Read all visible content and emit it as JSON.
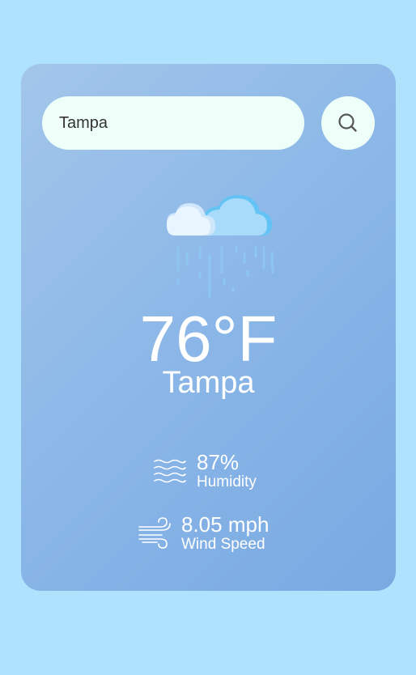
{
  "search": {
    "value": "Tampa",
    "button_icon": "search-icon"
  },
  "weather": {
    "icon": "rain-cloud-icon",
    "temperature": "76°F",
    "city": "Tampa"
  },
  "details": {
    "humidity": {
      "value": "87%",
      "label": "Humidity",
      "icon": "humidity-waves-icon"
    },
    "wind": {
      "value": "8.05 mph",
      "label": "Wind Speed",
      "icon": "wind-icon"
    }
  },
  "colors": {
    "page_background": "#aee2fd",
    "card_gradient_start": "#a3c6ea",
    "card_gradient_end": "#78a9e2",
    "input_background": "#eefff9",
    "text": "#ffffff"
  }
}
